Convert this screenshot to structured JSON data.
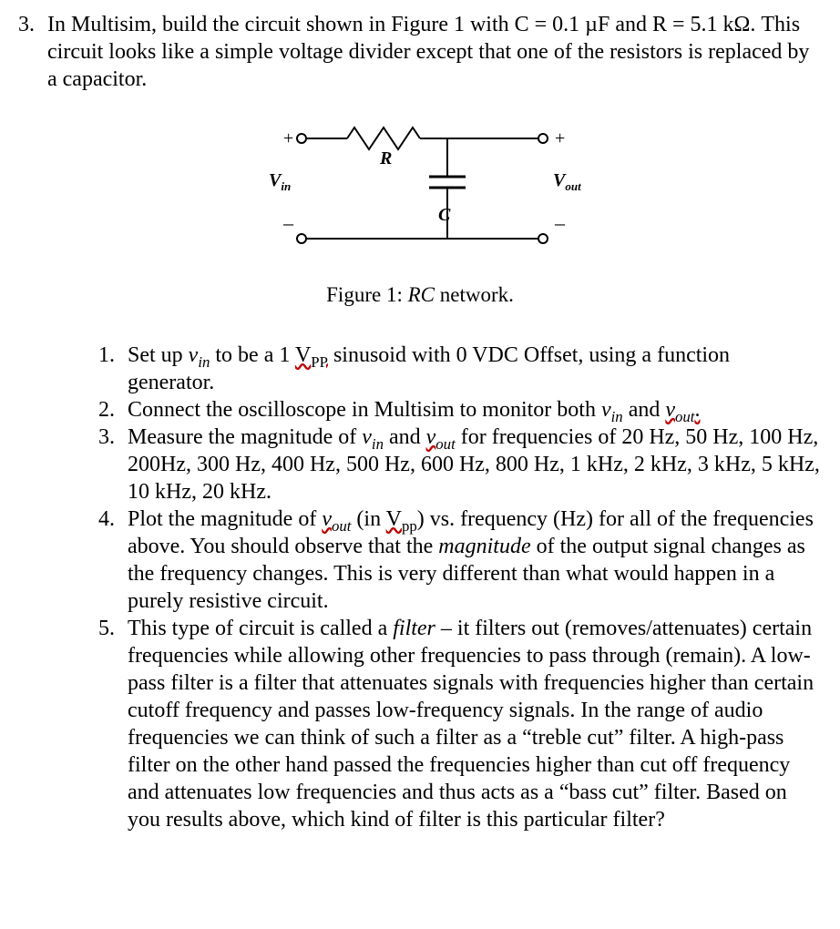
{
  "question": {
    "number": "3.",
    "intro": "In Multisim, build the circuit shown in Figure 1 with C = 0.1 µF and R = 5.1 kΩ.  This circuit looks like a simple voltage divider except that one of the resistors is replaced by a capacitor."
  },
  "figure": {
    "R_label": "R",
    "C_label": "C",
    "Vin_prefix": "V",
    "Vin_sub": "in",
    "Vout_prefix": "V",
    "Vout_sub": "out",
    "plus": "+",
    "minus_l": "–",
    "minus_r": "–",
    "caption_pre": "Figure 1: ",
    "caption_i": "RC",
    "caption_post": " network."
  },
  "steps": [
    {
      "n": "1.",
      "html": "Set up <span class=\"italic\">v<sub>in</sub></span> to be a 1 <span class=\"sq\">V<sub style=\"font-style:normal\">PP</sub></span> sinusoid with 0 VDC Offset, using a function generator."
    },
    {
      "n": "2.",
      "html": "Connect the oscilloscope in Multisim to monitor both <span class=\"italic\">v<sub>in</sub></span> and <span class=\"sq\"><span class=\"italic\">v<sub>out</sub></span>.</span>"
    },
    {
      "n": "3.",
      "html": "Measure the magnitude of <span class=\"italic\">v<sub>in</sub></span> and <span class=\"sq\"><span class=\"italic\">v<sub>out</sub></span></span> for frequencies of 20 Hz, 50 Hz, 100 Hz, 200Hz, 300 Hz, 400 Hz, 500 Hz, 600 Hz, 800 Hz, 1 kHz, 2 kHz, 3 kHz, 5 kHz, 10 kHz, 20 kHz."
    },
    {
      "n": "4.",
      "html": "Plot the magnitude of <span class=\"sq\"><span class=\"italic\">v<sub>out</sub></span></span> (in <span class=\"sq\">V<sub style=\"font-style:normal\">pp</sub></span>) vs. frequency (Hz) for all of the frequencies above.  You should observe that the <span class=\"italic\">magnitude</span> of the output signal changes as the frequency changes.  This is very different than what would happen in a purely resistive circuit."
    },
    {
      "n": "5.",
      "html": "This type of circuit is called a <span class=\"italic\">filter</span> – it filters out (removes/attenuates) certain frequencies while allowing other frequencies to pass through (remain).  A low-pass filter is a filter that attenuates signals with frequencies higher than certain cutoff frequency and passes low-frequency signals. In the range of audio frequencies we can think of such a filter as a “treble cut” filter. A high-pass filter on the other hand passed the frequencies higher than cut off frequency and attenuates low frequencies and thus acts as a “bass cut” filter.   Based on you results above, which kind of filter is this particular filter?"
    }
  ]
}
